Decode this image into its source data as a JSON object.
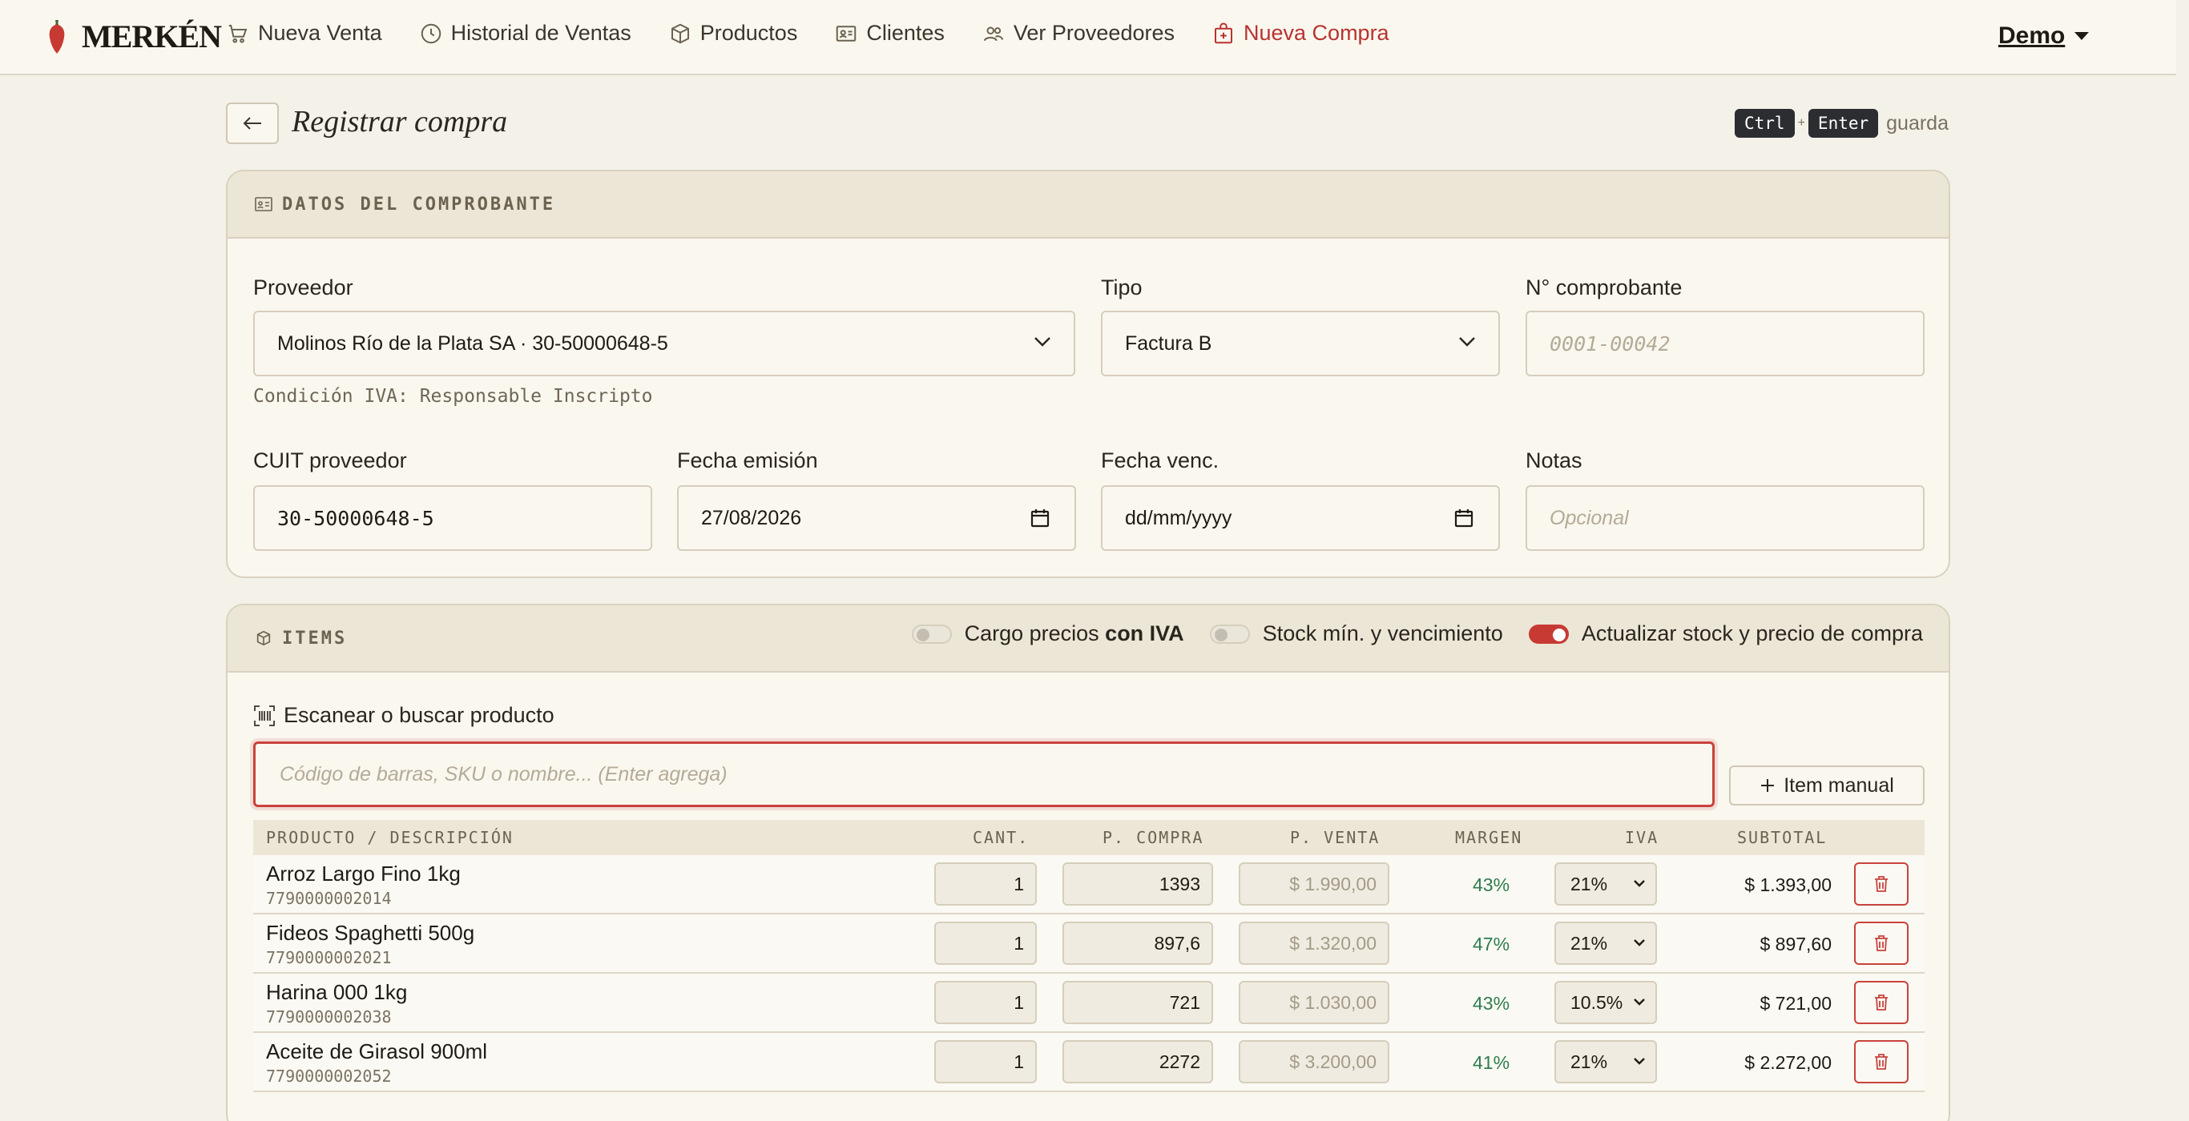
{
  "brand": {
    "name": "MERKÉN"
  },
  "nav": {
    "items": [
      {
        "label": "Nueva Venta",
        "icon": "cart-icon"
      },
      {
        "label": "Historial de Ventas",
        "icon": "clock-icon"
      },
      {
        "label": "Productos",
        "icon": "box-icon"
      },
      {
        "label": "Clientes",
        "icon": "id-card-icon"
      },
      {
        "label": "Ver Proveedores",
        "icon": "users-icon"
      },
      {
        "label": "Nueva Compra",
        "icon": "bag-plus-icon"
      }
    ],
    "user": "Demo"
  },
  "header": {
    "title": "Registrar compra",
    "shortcut": {
      "key1": "Ctrl",
      "plus": "+",
      "key2": "Enter",
      "suffix": "guarda"
    }
  },
  "comprobante": {
    "section_label": "DATOS DEL COMPROBANTE",
    "proveedor": {
      "label": "Proveedor",
      "value": "Molinos Río de la Plata SA · 30-50000648-5",
      "hint": "Condición IVA: Responsable Inscripto"
    },
    "tipo": {
      "label": "Tipo",
      "value": "Factura B"
    },
    "numero": {
      "label": "N° comprobante",
      "placeholder": "0001-00042"
    },
    "cuit": {
      "label": "CUIT proveedor",
      "value": "30-50000648-5"
    },
    "fecha_emision": {
      "label": "Fecha emisión",
      "value": "27/08/2026"
    },
    "fecha_venc": {
      "label": "Fecha venc.",
      "value": "dd/mm/yyyy"
    },
    "notas": {
      "label": "Notas",
      "placeholder": "Opcional"
    }
  },
  "items": {
    "section_label": "ITEMS",
    "toggles": {
      "con_iva": {
        "label": "Cargo precios",
        "bold": "con IVA",
        "on": false
      },
      "stock_min": {
        "label": "Stock mín. y vencimiento",
        "on": false
      },
      "actualizar": {
        "label": "Actualizar stock y precio de compra",
        "on": true
      }
    },
    "scan": {
      "label": "Escanear o buscar producto",
      "placeholder": "Código de barras, SKU o nombre... (Enter agrega)"
    },
    "manual_button": "Item manual",
    "columns": {
      "producto": "PRODUCTO / DESCRIPCIÓN",
      "cant": "CANT.",
      "p_compra": "P. COMPRA",
      "p_venta": "P. VENTA",
      "margen": "MARGEN",
      "iva": "IVA",
      "subtotal": "SUBTOTAL"
    },
    "rows": [
      {
        "name": "Arroz Largo Fino 1kg",
        "sku": "7790000002014",
        "cant": "1",
        "p_compra": "1393",
        "p_venta": "$ 1.990,00",
        "margen": "43%",
        "iva": "21%",
        "subtotal": "$ 1.393,00"
      },
      {
        "name": "Fideos Spaghetti 500g",
        "sku": "7790000002021",
        "cant": "1",
        "p_compra": "897,6",
        "p_venta": "$ 1.320,00",
        "margen": "47%",
        "iva": "21%",
        "subtotal": "$ 897,60"
      },
      {
        "name": "Harina 000 1kg",
        "sku": "7790000002038",
        "cant": "1",
        "p_compra": "721",
        "p_venta": "$ 1.030,00",
        "margen": "43%",
        "iva": "10.5%",
        "subtotal": "$ 721,00"
      },
      {
        "name": "Aceite de Girasol 900ml",
        "sku": "7790000002052",
        "cant": "1",
        "p_compra": "2272",
        "p_venta": "$ 3.200,00",
        "margen": "41%",
        "iva": "21%",
        "subtotal": "$ 2.272,00"
      }
    ]
  }
}
